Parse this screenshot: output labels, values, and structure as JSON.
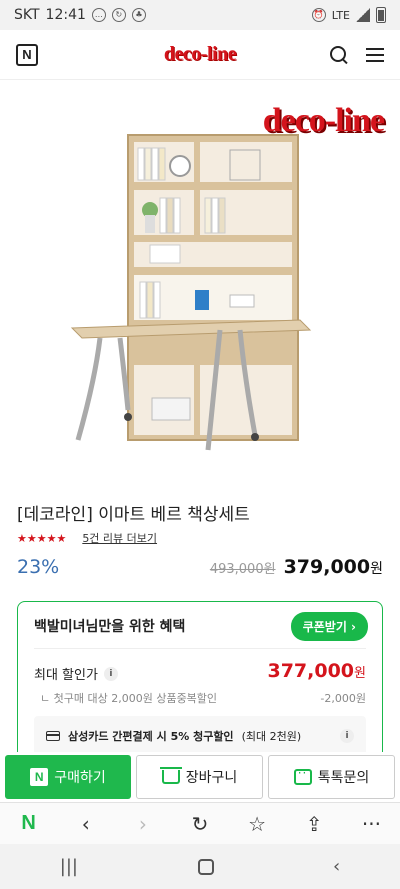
{
  "statusbar": {
    "carrier": "SKT",
    "time": "12:41",
    "network": "LTE"
  },
  "header": {
    "n_logo": "N",
    "brand": "deco-line"
  },
  "product": {
    "image_brand": "deco-line",
    "title": "[데코라인] 이마트 베르 책상세트",
    "rating_stars": 4.5,
    "review_link": "5건 리뷰 더보기",
    "discount": "23%",
    "original_price": "493,000원",
    "price": "379,000",
    "price_unit": "원"
  },
  "benefit": {
    "title": "백발미녀님만을 위한 혜택",
    "coupon_button": "쿠폰받기",
    "max_label": "최대 할인가",
    "max_price": "377,000",
    "max_price_unit": "원",
    "first_purchase": "첫구매 대상 2,000원 상품중복할인",
    "first_purchase_amount": "-2,000원",
    "card_text_bold": "삼성카드 간편결제 시 5% 청구할인",
    "card_text_rest": "(최대 2천원)"
  },
  "actions": {
    "buy": "구매하기",
    "cart": "장바구니",
    "talk": "톡톡문의",
    "buy_n": "N"
  },
  "browser": {
    "n_logo": "N"
  },
  "colors": {
    "brand_red": "#d4141c",
    "naver_green": "#1fb84d",
    "discount_blue": "#3a6fb0"
  }
}
